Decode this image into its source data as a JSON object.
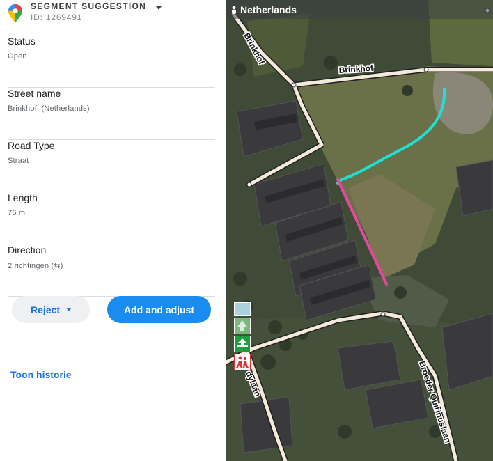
{
  "header": {
    "title": "SEGMENT SUGGESTION",
    "id": "ID: 1269491"
  },
  "fields": [
    {
      "label": "Status",
      "value": "Open"
    },
    {
      "label": "Street name",
      "value": "Brinkhof:  (Netherlands)"
    },
    {
      "label": "Road Type",
      "value": "Straat"
    },
    {
      "label": "Length",
      "value": "76 m"
    },
    {
      "label": "Direction",
      "value": "2 richtingen (⇆)"
    }
  ],
  "actions": {
    "reject": "Reject",
    "add": "Add and adjust",
    "history": "Toon historie"
  },
  "map": {
    "country": "Netherlands",
    "street_labels": [
      "Brinkhof",
      "Broeder Quirinuslaan",
      "dylaan"
    ],
    "suggested_segment_color": "#e8479f",
    "existing_path_color": "#1de0d6",
    "road_color": "#f4eadc"
  },
  "colors": {
    "accent": "#1a73e8",
    "primary_button": "#1a8cf0"
  }
}
